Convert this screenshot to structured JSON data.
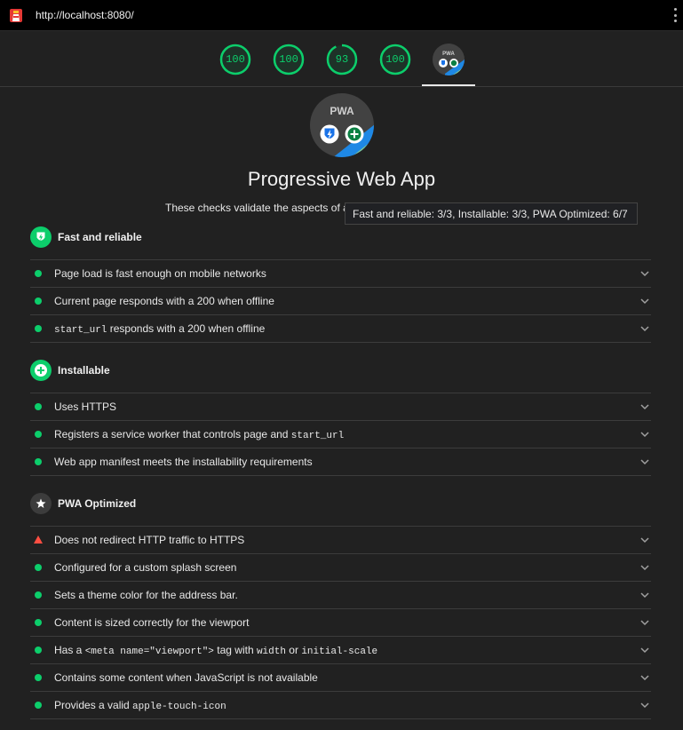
{
  "browser": {
    "url": "http://localhost:8080/"
  },
  "scores": [
    {
      "value": "100",
      "fraction": 1.0
    },
    {
      "value": "100",
      "fraction": 1.0
    },
    {
      "value": "93",
      "fraction": 0.93
    },
    {
      "value": "100",
      "fraction": 1.0
    }
  ],
  "pwa_badge": {
    "text": "PWA"
  },
  "colors": {
    "pass": "#0cce6b",
    "fail": "#ff4e42",
    "background": "#212121"
  },
  "header": {
    "title": "Progressive Web App",
    "description": "These checks validate the aspects of a",
    "tooltip": "Fast and reliable: 3/3, Installable: 3/3, PWA Optimized: 6/7"
  },
  "groups": [
    {
      "title": "Fast and reliable",
      "icon": "lightning-shield-icon",
      "audits": [
        {
          "status": "pass",
          "parts": [
            "Page load is fast enough on mobile networks"
          ]
        },
        {
          "status": "pass",
          "parts": [
            "Current page responds with a 200 when offline"
          ]
        },
        {
          "status": "pass",
          "parts": [
            "start_url",
            " responds with a 200 when offline"
          ]
        }
      ]
    },
    {
      "title": "Installable",
      "icon": "plus-circle-icon",
      "audits": [
        {
          "status": "pass",
          "parts": [
            "Uses HTTPS"
          ]
        },
        {
          "status": "pass",
          "parts": [
            "Registers a service worker that controls page and ",
            "start_url"
          ]
        },
        {
          "status": "pass",
          "parts": [
            "Web app manifest meets the installability requirements"
          ]
        }
      ]
    },
    {
      "title": "PWA Optimized",
      "icon": "star-icon",
      "audits": [
        {
          "status": "fail",
          "parts": [
            "Does not redirect HTTP traffic to HTTPS"
          ]
        },
        {
          "status": "pass",
          "parts": [
            "Configured for a custom splash screen"
          ]
        },
        {
          "status": "pass",
          "parts": [
            "Sets a theme color for the address bar."
          ]
        },
        {
          "status": "pass",
          "parts": [
            "Content is sized correctly for the viewport"
          ]
        },
        {
          "status": "pass",
          "parts": [
            "Has a ",
            "<meta name=\"viewport\">",
            " tag with ",
            "width",
            " or ",
            "initial-scale"
          ]
        },
        {
          "status": "pass",
          "parts": [
            "Contains some content when JavaScript is not available"
          ]
        },
        {
          "status": "pass",
          "parts": [
            "Provides a valid ",
            "apple-touch-icon"
          ]
        }
      ]
    }
  ]
}
